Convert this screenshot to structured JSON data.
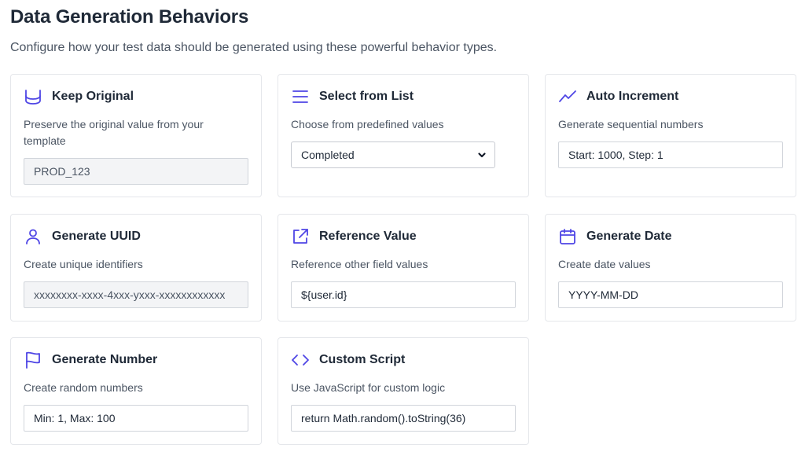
{
  "header": {
    "title": "Data Generation Behaviors",
    "subtitle": "Configure how your test data should be generated using these powerful behavior types."
  },
  "accent_color": "#4f46e5",
  "cards": [
    {
      "title": "Keep Original",
      "icon": "database-icon",
      "description": "Preserve the original value from your template",
      "field": {
        "value": "PROD_123",
        "readonly": true
      }
    },
    {
      "title": "Select from List",
      "icon": "list-icon",
      "description": "Choose from predefined values",
      "field": {
        "selected": "Completed",
        "type": "select"
      }
    },
    {
      "title": "Auto Increment",
      "icon": "trending-up-icon",
      "description": "Generate sequential numbers",
      "field": {
        "value": "Start: 1000, Step: 1"
      }
    },
    {
      "title": "Generate UUID",
      "icon": "user-icon",
      "description": "Create unique identifiers",
      "field": {
        "value": "xxxxxxxx-xxxx-4xxx-yxxx-xxxxxxxxxxxx",
        "readonly": true
      }
    },
    {
      "title": "Reference Value",
      "icon": "external-link-icon",
      "description": "Reference other field values",
      "field": {
        "value": "${user.id}"
      }
    },
    {
      "title": "Generate Date",
      "icon": "calendar-icon",
      "description": "Create date values",
      "field": {
        "value": "YYYY-MM-DD"
      }
    },
    {
      "title": "Generate Number",
      "icon": "flag-icon",
      "description": "Create random numbers",
      "field": {
        "value": "Min: 1, Max: 100"
      }
    },
    {
      "title": "Custom Script",
      "icon": "code-icon",
      "description": "Use JavaScript for custom logic",
      "field": {
        "value": "return Math.random().toString(36)"
      }
    }
  ]
}
